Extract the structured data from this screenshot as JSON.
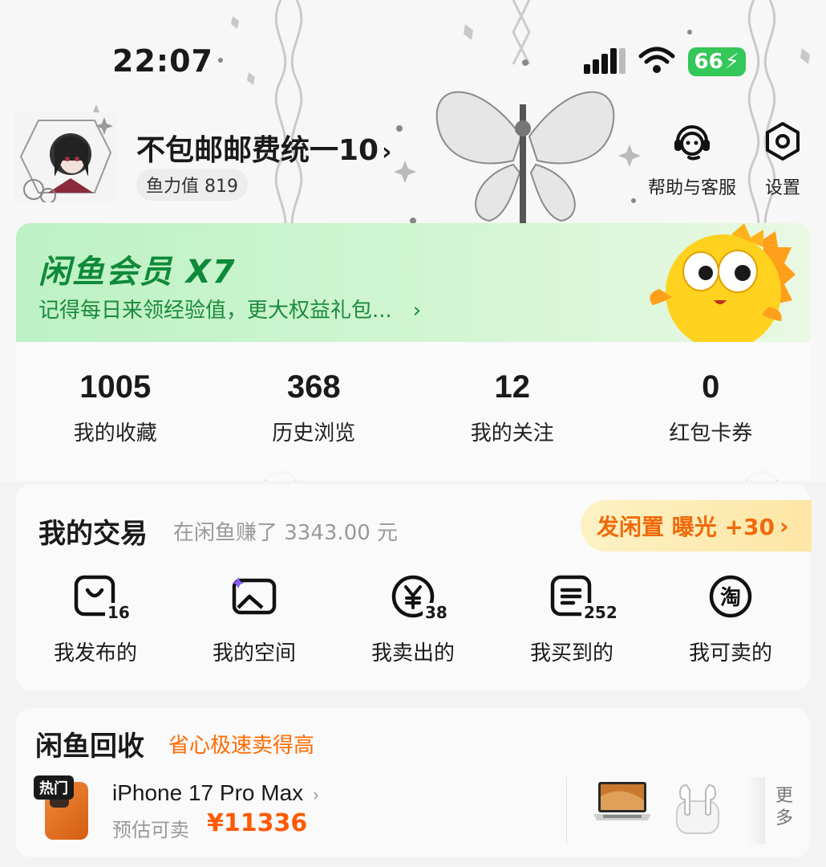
{
  "status_bar": {
    "time": "22:07",
    "battery": "66"
  },
  "profile": {
    "username": "不包邮邮费统一10",
    "fish_power": "鱼力值 819",
    "help_label": "帮助与客服",
    "settings_label": "设置"
  },
  "member": {
    "title": "闲鱼会员 X7",
    "subtitle": "记得每日来领经验值，更大权益礼包..."
  },
  "stats": [
    {
      "value": "1005",
      "label": "我的收藏"
    },
    {
      "value": "368",
      "label": "历史浏览"
    },
    {
      "value": "12",
      "label": "我的关注"
    },
    {
      "value": "0",
      "label": "红包卡券"
    }
  ],
  "trade": {
    "title": "我的交易",
    "earned": "在闲鱼赚了 3343.00 元",
    "post_button": "发闲置 曝光 +30",
    "items": [
      {
        "label": "我发布的",
        "count": "16",
        "icon": "bag-icon"
      },
      {
        "label": "我的空间",
        "count": "",
        "icon": "image-space-icon"
      },
      {
        "label": "我卖出的",
        "count": "38",
        "icon": "yen-icon"
      },
      {
        "label": "我买到的",
        "count": "252",
        "icon": "order-list-icon"
      },
      {
        "label": "我可卖的",
        "count": "",
        "icon": "tao-icon"
      }
    ]
  },
  "recycle": {
    "title": "闲鱼回收",
    "subtitle": "省心极速卖得高",
    "hot_badge": "热门",
    "product": "iPhone 17 Pro Max",
    "estimate_label": "预估可卖",
    "estimate_price": "¥11336",
    "more_label": "更多"
  },
  "colors": {
    "accent_green": "#0f8a3a",
    "accent_orange": "#ff5a00",
    "battery_green": "#34c759"
  }
}
